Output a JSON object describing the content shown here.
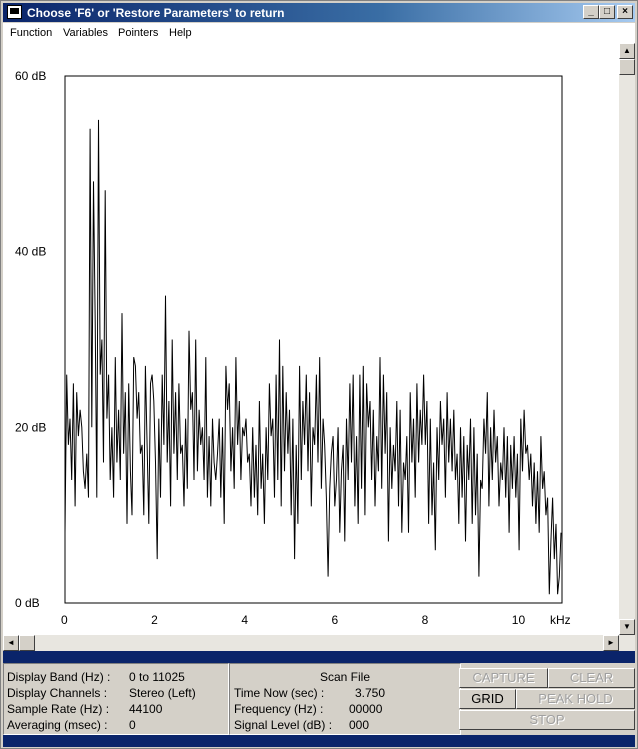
{
  "window": {
    "title": "Choose 'F6' or 'Restore Parameters' to return",
    "min_label": "_",
    "max_label": "□",
    "close_label": "×"
  },
  "menu": [
    "Function",
    "Variables",
    "Pointers",
    "Help"
  ],
  "chart_data": {
    "type": "line",
    "y_ticks": [
      "60 dB",
      "40 dB",
      "20 dB",
      "0 dB"
    ],
    "x_ticks": [
      "0",
      "2",
      "4",
      "6",
      "8",
      "10"
    ],
    "x_unit": "kHz",
    "ylim": [
      0,
      60
    ],
    "xlim": [
      0,
      11025
    ],
    "grid": false,
    "series": [
      {
        "values": [
          8,
          26,
          18,
          21,
          14,
          25,
          11,
          24,
          19,
          22,
          20,
          15,
          13,
          17,
          12,
          54,
          20,
          48,
          32,
          12,
          55,
          26,
          30,
          16,
          47,
          21,
          26,
          14,
          20,
          12,
          28,
          16,
          22,
          14,
          33,
          17,
          24,
          9,
          25,
          15,
          10,
          28,
          27,
          21,
          24,
          17,
          18,
          10,
          27,
          18,
          9,
          25,
          26,
          23,
          16,
          5,
          21,
          12,
          26,
          18,
          35,
          16,
          23,
          11,
          30,
          17,
          24,
          14,
          25,
          17,
          18,
          11,
          21,
          13,
          31,
          22,
          24,
          14,
          30,
          15,
          22,
          18,
          20,
          14,
          28,
          12,
          19,
          11,
          21,
          16,
          14,
          17,
          21,
          12,
          20,
          9,
          27,
          22,
          25,
          15,
          20,
          13,
          28,
          18,
          23,
          14,
          20,
          19,
          21,
          16,
          17,
          11,
          20,
          12,
          18,
          10,
          23,
          13,
          17,
          9,
          20,
          14,
          25,
          19,
          21,
          12,
          26,
          14,
          30,
          11,
          27,
          15,
          24,
          17,
          22,
          10,
          21,
          5,
          18,
          9,
          27,
          14,
          23,
          18,
          26,
          15,
          24,
          11,
          20,
          18,
          26,
          16,
          28,
          13,
          21,
          18,
          12,
          3,
          13,
          17,
          19,
          11,
          14,
          20,
          8,
          15,
          18,
          7,
          21,
          14,
          25,
          16,
          26,
          11,
          19,
          9,
          26,
          13,
          27,
          10,
          25,
          20,
          23,
          14,
          22,
          11,
          19,
          15,
          28,
          13,
          26,
          17,
          24,
          7,
          20,
          13,
          18,
          15,
          23,
          11,
          22,
          8,
          16,
          14,
          19,
          8,
          24,
          16,
          21,
          12,
          25,
          16,
          22,
          18,
          26,
          18,
          23,
          9,
          21,
          10,
          16,
          6,
          20,
          14,
          23,
          18,
          21,
          12,
          24,
          16,
          21,
          15,
          22,
          14,
          17,
          9,
          20,
          12,
          19,
          7,
          18,
          14,
          21,
          9,
          20,
          10,
          17,
          3,
          14,
          13,
          21,
          17,
          24,
          11,
          20,
          14,
          22,
          16,
          19,
          11,
          16,
          14,
          20,
          12,
          19,
          8,
          18,
          13,
          19,
          12,
          17,
          6,
          21,
          15,
          22,
          17,
          18,
          14,
          17,
          11,
          16,
          9,
          15,
          8,
          19,
          13,
          15,
          10,
          12,
          1,
          7,
          12,
          5,
          9,
          1,
          3,
          8
        ]
      }
    ]
  },
  "status": {
    "left": [
      {
        "label": "Display Band (Hz) :",
        "value": "0 to 11025"
      },
      {
        "label": "Display Channels :",
        "value": "Stereo (Left)"
      },
      {
        "label": "Sample Rate (Hz) :",
        "value": "44100"
      },
      {
        "label": "Averaging (msec) :",
        "value": "0"
      }
    ],
    "mid_title": "Scan File",
    "mid": [
      {
        "label": "Time Now (sec) :",
        "value": "3.750"
      },
      {
        "label": "Frequency (Hz) :",
        "value": "00000"
      },
      {
        "label": "Signal Level (dB) :",
        "value": "000"
      }
    ]
  },
  "buttons": {
    "capture": "CAPTURE",
    "clear": "CLEAR",
    "grid": "GRID",
    "peak_hold": "PEAK HOLD",
    "stop": "STOP"
  },
  "scroll": {
    "up": "▲",
    "down": "▼",
    "left": "◄",
    "right": "►"
  }
}
